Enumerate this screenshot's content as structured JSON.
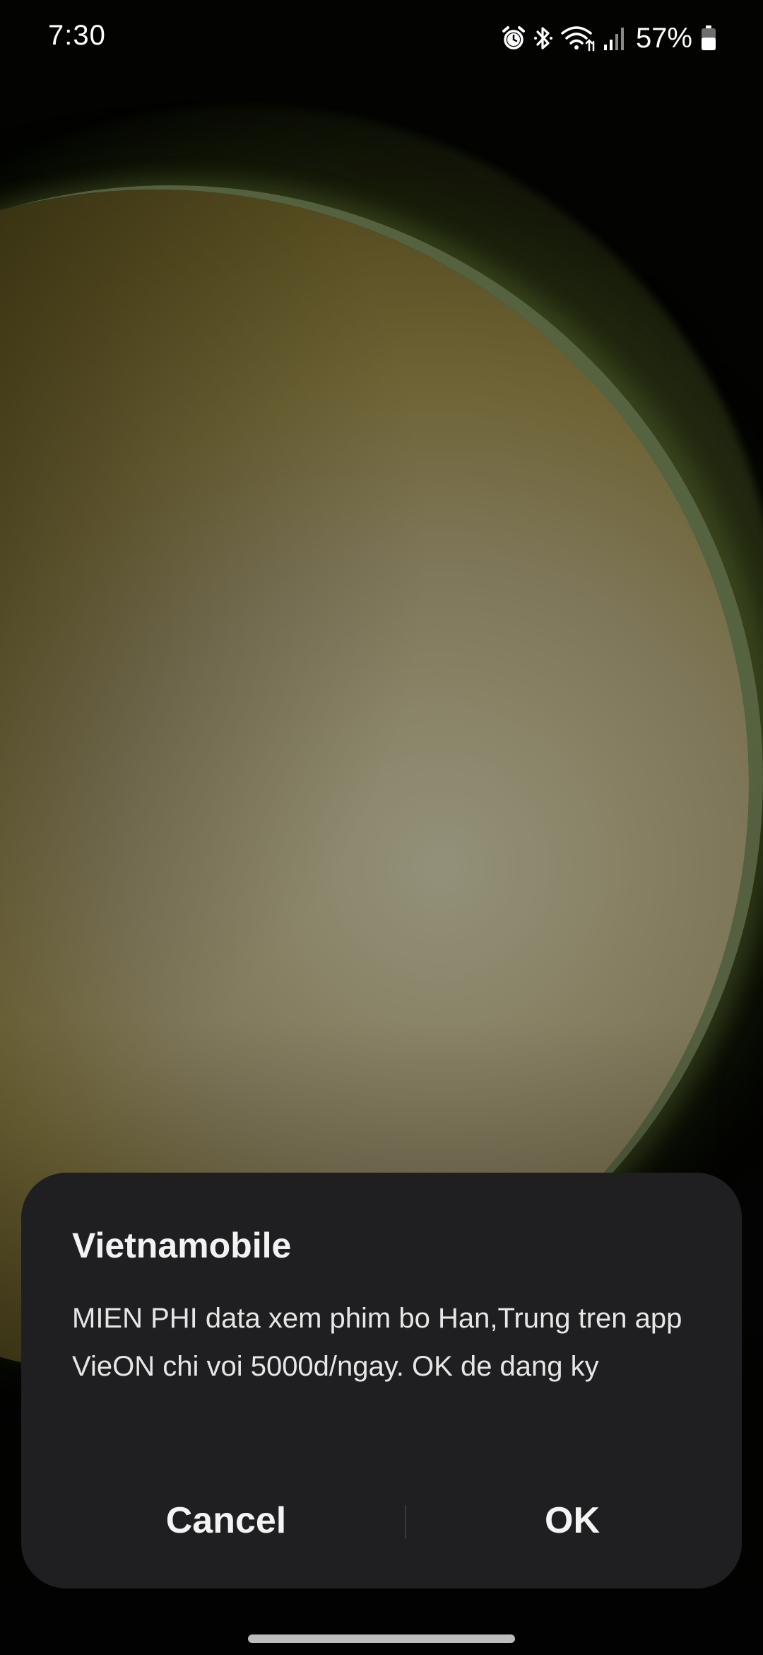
{
  "status_bar": {
    "time": "7:30",
    "battery_percent": "57%",
    "battery_level": 0.57,
    "icons": [
      "alarm-icon",
      "bluetooth-icon",
      "wifi-icon",
      "signal-icon",
      "battery-icon"
    ]
  },
  "dialog": {
    "title": "Vietnamobile",
    "message": "MIEN PHI data xem phim bo Han,Trung tren app VieON chi voi 5000d/ngay. OK de dang ky",
    "cancel_label": "Cancel",
    "ok_label": "OK"
  },
  "colors": {
    "dialog_background": "#1f1f21",
    "text_primary": "#f2f2f2"
  }
}
